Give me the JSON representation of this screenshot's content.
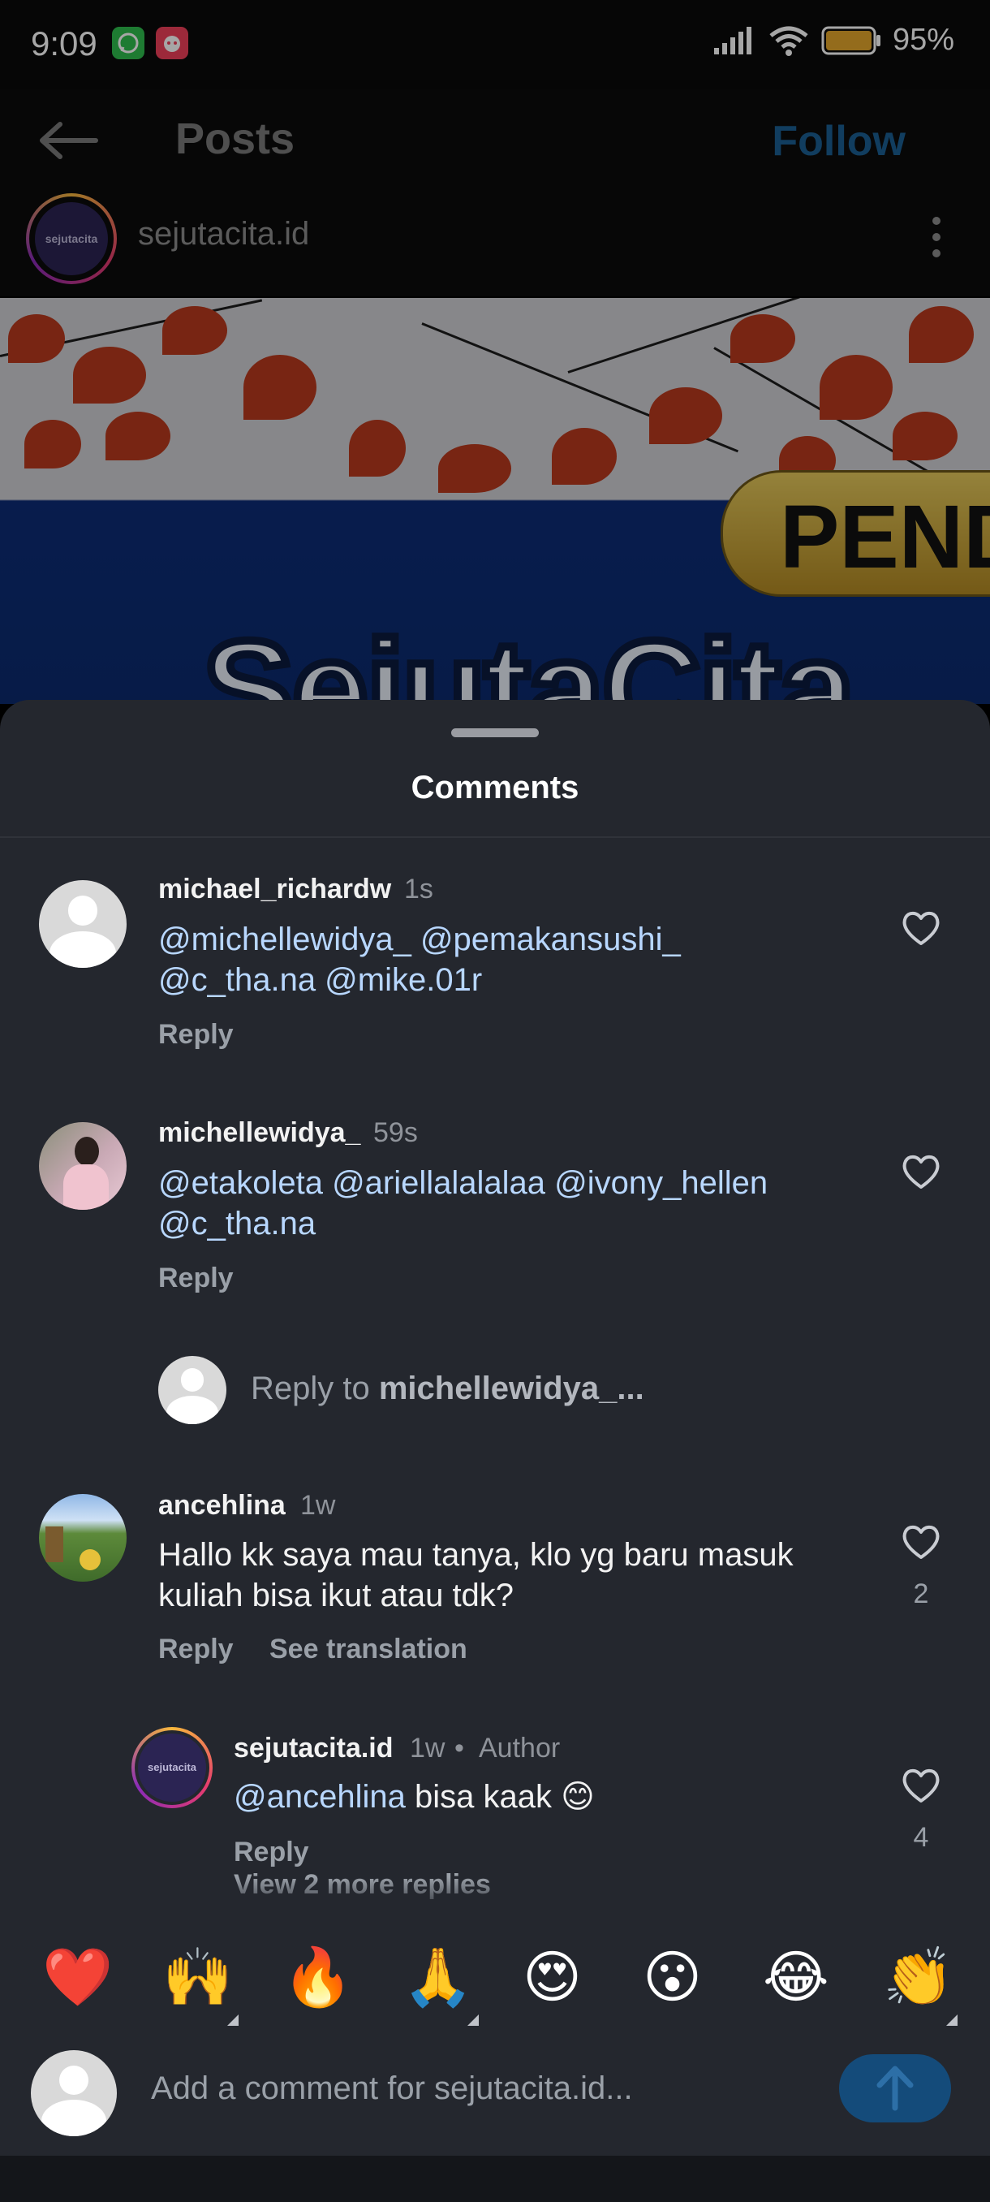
{
  "status_bar": {
    "time": "9:09",
    "battery": "95%"
  },
  "header": {
    "title": "Posts",
    "follow_label": "Follow"
  },
  "post": {
    "username": "sejutacita.id",
    "logo_text": "sejutacita",
    "image_badge_text": "PEND",
    "image_big_text": "SejutaCita"
  },
  "comments_sheet": {
    "title": "Comments",
    "comments": [
      {
        "user": "michael_richardw",
        "time": "1s",
        "mentions_line1": "@michellewidya_ @pemakansushi_",
        "mentions_line2": "@c_tha.na @mike.01r",
        "reply": "Reply"
      },
      {
        "user": "michellewidya_",
        "time": "59s",
        "mentions_line1": "@etakoleta @ariellalalalaa @ivony_hellen",
        "mentions_line2": "@c_tha.na",
        "reply": "Reply"
      },
      {
        "user": "ancehlina",
        "time": "1w",
        "text_line1": "Hallo kk saya mau tanya, klo yg baru masuk",
        "text_line2": "kuliah bisa ikut atau tdk?",
        "reply": "Reply",
        "translate": "See translation",
        "likes": "2"
      }
    ],
    "reply_prompt_prefix": "Reply to ",
    "reply_prompt_user": "michellewidya_...",
    "author_reply": {
      "user": "sejutacita.id",
      "time": "1w",
      "badge": "Author",
      "mention": "@ancehlina",
      "text": " bisa kaak 😊",
      "reply": "Reply",
      "likes": "4"
    },
    "view_more": "View 2 more replies"
  },
  "emoji_bar": [
    "❤️",
    "🙌",
    "🔥",
    "🙏",
    "😍",
    "😮",
    "😂",
    "👏"
  ],
  "comment_input": {
    "placeholder": "Add a comment for sejutacita.id..."
  }
}
